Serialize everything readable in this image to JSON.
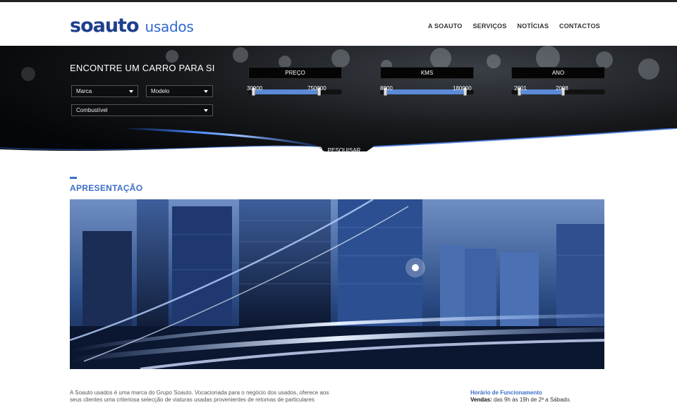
{
  "brand": {
    "logo_main": "soauto",
    "logo_sub": "usados",
    "color_primary": "#1e3f8c",
    "color_accent": "#3c6fc8"
  },
  "nav": {
    "items": [
      "A SOAUTO",
      "SERVIÇOS",
      "NOTÍCIAS",
      "CONTACTOS"
    ]
  },
  "search": {
    "title": "ENCONTRE UM CARRO PARA SI",
    "marca": "Marca",
    "modelo": "Modelo",
    "combustivel": "Combustível",
    "button_label": "PESQUISAR",
    "button_icon": "search-icon",
    "ranges": [
      {
        "label": "PREÇO",
        "min": "30000",
        "max": "750000",
        "fill_start": 0.05,
        "fill_end": 0.75
      },
      {
        "label": "KMS",
        "min": "8000",
        "max": "180000",
        "fill_start": 0.05,
        "fill_end": 0.9
      },
      {
        "label": "ANO",
        "min": "2001",
        "max": "2008",
        "fill_start": 0.08,
        "fill_end": 0.55
      }
    ]
  },
  "section": {
    "title": "APRESENTAÇÃO",
    "paragraph": "A Soauto usados é uma marca do Grupo Soauto. Vocacionada para o negócio dos usados, oferece aos seus clientes uma criteriosa selecção de viaturas usadas provenientes de retomas de particulares"
  },
  "hours": {
    "title": "Horário de Funcionamento",
    "label": "Vendas:",
    "text": "das 9h às 19h de 2ª a Sábado."
  }
}
